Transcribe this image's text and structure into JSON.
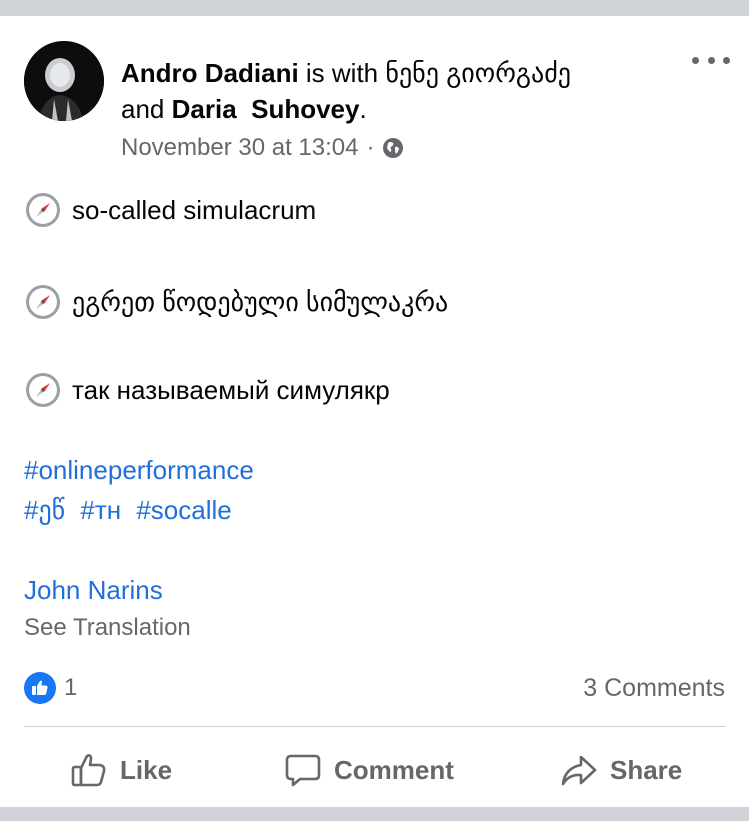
{
  "post": {
    "author": "Andro Dadiani",
    "with_text": "is with",
    "tag_one": "ნენე გიორგაძე",
    "and_text": "and",
    "tag_two": "Daria  Suhovey",
    "period": ".",
    "timestamp": "November 30 at 13:04",
    "meta_dot": "·",
    "privacy_icon": "globe-icon",
    "lines": [
      {
        "icon": "compass-emoji",
        "text": "so-called simulacrum"
      },
      {
        "icon": "compass-emoji",
        "text": "ეგრეთ წოდებული სიმულაკრა"
      },
      {
        "icon": "compass-emoji",
        "text": "так называемый симулякр"
      }
    ],
    "hashtags_line1": [
      "#onlineperformance"
    ],
    "hashtags_line2": [
      "#ეწ",
      "#тн",
      "#socalle"
    ],
    "mentioned": "John Narins",
    "see_translation": "See Translation"
  },
  "reactions": {
    "icon": "thumbs-up-badge-icon",
    "count": "1",
    "comments": "3 Comments"
  },
  "actions": {
    "like": "Like",
    "comment": "Comment",
    "share": "Share"
  },
  "colors": {
    "link": "#216fdb",
    "secondary_text": "#65676b",
    "like_blue": "#1877f2",
    "separator": "#d0d3d8"
  }
}
